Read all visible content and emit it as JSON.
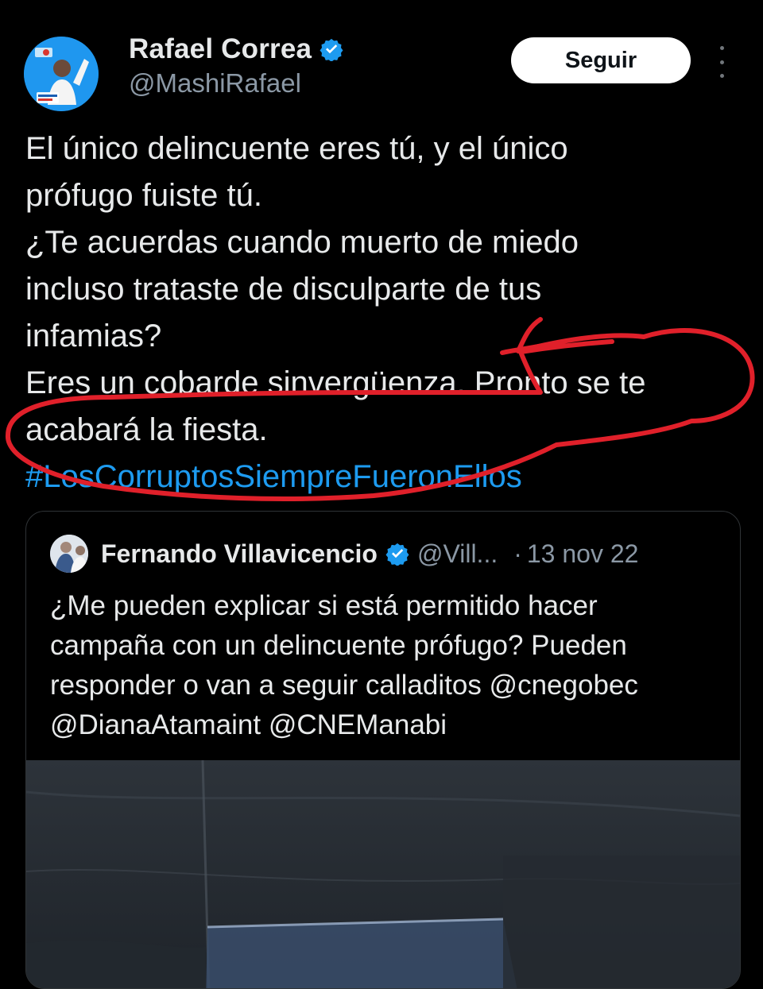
{
  "tweet": {
    "author": {
      "name": "Rafael Correa",
      "handle": "@MashiRafael",
      "verified": true
    },
    "follow_label": "Seguir",
    "text_lines": [
      "El único delincuente eres tú, y el único",
      "prófugo fuiste tú.",
      "¿Te acuerdas cuando muerto de miedo",
      "incluso trataste de disculparte de tus",
      "infamias?",
      "Eres un cobarde sinvergüenza. Pronto se te",
      "acabará la fiesta."
    ],
    "hashtag": "#LosCorruptosSiempreFueronEllos",
    "annotation_color": "#e0202a"
  },
  "quoted_tweet": {
    "author": {
      "name": "Fernando Villavicencio",
      "handle": "@Vill...",
      "verified": true
    },
    "separator": "·",
    "date": "13 nov 22",
    "text_lines": [
      "¿Me pueden explicar si está permitido hacer",
      "campaña con un delincuente prófugo? Pueden",
      "responder o van a seguir calladitos @cnegobec",
      "@DianaAtamaint @CNEManabi"
    ]
  },
  "icons": {
    "verified": "verified-badge-icon",
    "more": "more-options-icon"
  },
  "colors": {
    "background": "#000000",
    "text": "#e7e9ea",
    "secondary": "#8b98a5",
    "link": "#1d9bf0",
    "verified": "#1d9bf0"
  }
}
